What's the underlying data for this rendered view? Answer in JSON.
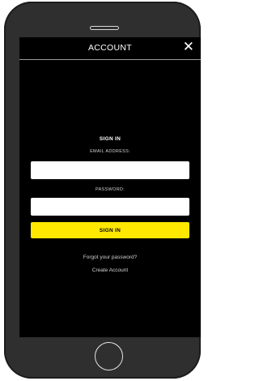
{
  "header": {
    "title": "ACCOUNT",
    "close_icon": "close-icon"
  },
  "signin": {
    "section_title": "SIGN IN",
    "email_label": "EMAIL ADDRESS:",
    "email_value": "",
    "password_label": "PASSWORD:",
    "password_value": "",
    "button_label": "SIGN IN",
    "forgot_link": "Forgot your password?",
    "create_link": "Create Account"
  },
  "colors": {
    "screen_background": "#000000",
    "accent_button": "#ffe800",
    "phone_frame": "#2f2f2f"
  }
}
